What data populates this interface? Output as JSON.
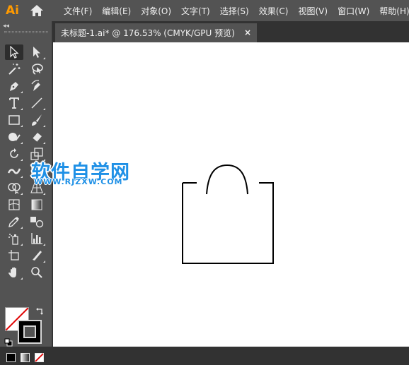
{
  "app": {
    "logo": "Ai"
  },
  "menu": [
    "文件(F)",
    "编辑(E)",
    "对象(O)",
    "文字(T)",
    "选择(S)",
    "效果(C)",
    "视图(V)",
    "窗口(W)",
    "帮助(H)"
  ],
  "panel": {
    "collapse_glyph": "◂◂"
  },
  "document_tab": {
    "title": "未标题-1.ai* @ 176.53% (CMYK/GPU 预览)",
    "close_glyph": "×"
  },
  "watermark": {
    "title": "软件自学网",
    "url": "WWW.RJZXW.COM"
  },
  "colors": {
    "accent": "#ff9a00",
    "watermark": "#1e90e6",
    "panel": "#535353",
    "background": "#323232",
    "canvas": "#ffffff"
  },
  "tools": [
    "selection-tool",
    "direct-selection-tool",
    "magic-wand-tool",
    "lasso-tool",
    "pen-tool",
    "curvature-tool",
    "type-tool",
    "line-segment-tool",
    "rectangle-tool",
    "paintbrush-tool",
    "shaper-tool",
    "eraser-tool",
    "rotate-tool",
    "scale-tool",
    "width-tool",
    "free-transform-tool",
    "shape-builder-tool",
    "perspective-grid-tool",
    "mesh-tool",
    "gradient-tool",
    "eyedropper-tool",
    "blend-tool",
    "symbol-sprayer-tool",
    "column-graph-tool",
    "artboard-tool",
    "slice-tool",
    "hand-tool",
    "zoom-tool"
  ]
}
